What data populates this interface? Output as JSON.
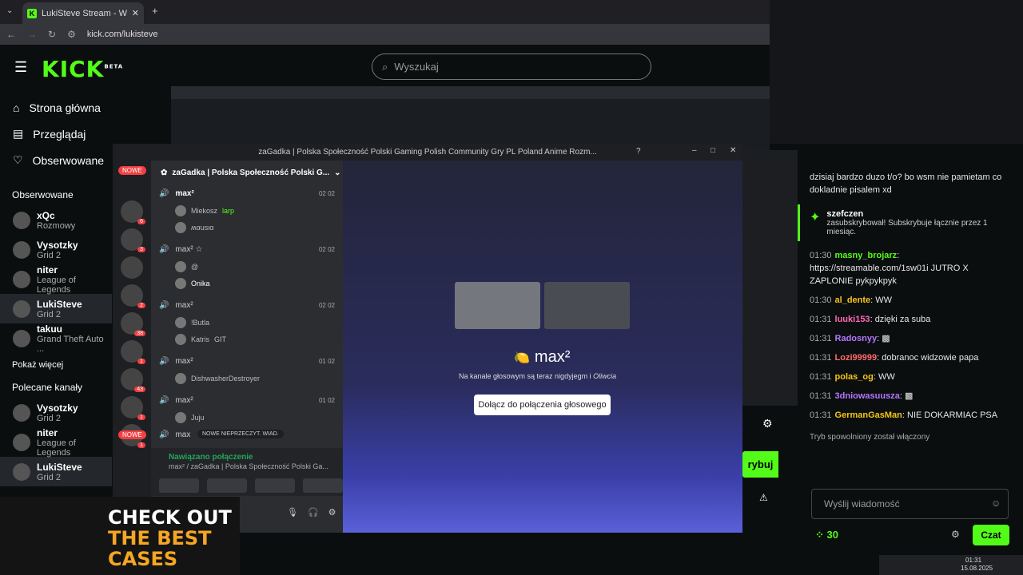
{
  "browser": {
    "tab_title": "LukiSteve Stream - Watch Live",
    "url": "kick.com/lukisteve"
  },
  "kick": {
    "logo": "KICK",
    "logo_badge": "BETA",
    "search_placeholder": "Wyszukaj",
    "nav": [
      {
        "icon": "home-icon",
        "label": "Strona główna"
      },
      {
        "icon": "browse-icon",
        "label": "Przeglądaj"
      },
      {
        "icon": "heart-icon",
        "label": "Obserwowane"
      }
    ],
    "followed_title": "Obserwowane",
    "followed": [
      {
        "name": "xQc",
        "game": "Rozmowy"
      },
      {
        "name": "Vysotzky",
        "game": "Grid 2"
      },
      {
        "name": "niter",
        "game": "League of Legends"
      },
      {
        "name": "LukiSteve",
        "game": "Grid 2"
      },
      {
        "name": "takuu",
        "game": "Grand Theft Auto ..."
      }
    ],
    "show_more": "Pokaż więcej",
    "recommended_title": "Polecane kanały",
    "recommended": [
      {
        "name": "Vysotzky",
        "game": "Grid 2"
      },
      {
        "name": "niter",
        "game": "League of Legends"
      },
      {
        "name": "LukiSteve",
        "game": "Grid 2"
      }
    ],
    "subscribe_btn": "rybuj"
  },
  "discord": {
    "title": "zaGadka | Polska Społeczność Polski Gaming Polish Community Gry PL Poland Anime Rozm...",
    "server_name": "zaGadka | Polska Społeczność Polski G...",
    "new_label": "NOWE",
    "server_badges": [
      "6",
      "3",
      "",
      "2",
      "38",
      "1",
      "43",
      "1",
      "1"
    ],
    "voice_channels": [
      {
        "name": "max²",
        "count_a": "02",
        "count_b": "02",
        "users": [
          {
            "name": "Miekosz",
            "tag": "larp"
          },
          {
            "name": "ʍαusια",
            "tag": ""
          }
        ]
      },
      {
        "name": "max² ☆",
        "count_a": "02",
        "count_b": "02",
        "users": [
          {
            "name": "@",
            "tag": ""
          },
          {
            "name": "Onika",
            "tag": ""
          }
        ]
      },
      {
        "name": "max²",
        "count_a": "02",
        "count_b": "02",
        "users": [
          {
            "name": "!Butla",
            "tag": ""
          },
          {
            "name": "Katris",
            "tag": "GIT"
          }
        ]
      },
      {
        "name": "max²",
        "count_a": "01",
        "count_b": "02",
        "users": [
          {
            "name": "DishwasherDestroyer",
            "tag": ""
          }
        ]
      },
      {
        "name": "max²",
        "count_a": "01",
        "count_b": "02",
        "users": [
          {
            "name": "Juju",
            "tag": ""
          }
        ]
      },
      {
        "name": "max",
        "count_a": "",
        "count_b": "",
        "users": []
      }
    ],
    "unread_pill": "NOWE NIEPRZECZYT. WIAD.",
    "connected_status": "Nawiązano połączenie",
    "connected_channel": "max² / zaGadka | Polska Społeczność Polski Ga...",
    "voice_channel_title": "max²",
    "voice_subtitle": "Na kanale głosowym są teraz nigdyjegm i",
    "voice_subtitle_name": "Oliwcia",
    "join_button": "Dołącz do połączenia głosowego"
  },
  "chat": {
    "messages": [
      {
        "time": "",
        "user": "",
        "text": "dzisiaj bardzo duzo t/o? bo wsm nie pamietam co dokladnie pisalem xd",
        "color": "#ffffff"
      },
      {
        "time": "01:30",
        "user": "masny_brojarz",
        "text": "https://streamable.com/1sw01i JUTRO X ZAPLONIE pykpykpyk",
        "color": "#53fc18"
      },
      {
        "time": "01:30",
        "user": "al_dente",
        "text": "WW",
        "color": "#f5c518"
      },
      {
        "time": "01:31",
        "user": "luuki153",
        "text": "dzięki za suba",
        "color": "#ff69b4"
      },
      {
        "time": "01:31",
        "user": "Radosnyy",
        "text": "",
        "color": "#b478ff"
      },
      {
        "time": "01:31",
        "user": "Lozi99999",
        "text": "dobranoc widzowie papa",
        "color": "#ff6b6b"
      },
      {
        "time": "01:31",
        "user": "polas_og",
        "text": "WW",
        "color": "#f5c518"
      },
      {
        "time": "01:31",
        "user": "3dniowasuusza",
        "text": "",
        "color": "#b478ff"
      },
      {
        "time": "01:31",
        "user": "GermanGasMan",
        "text": "NIE DOKARMIAC PSA",
        "color": "#f5c518"
      }
    ],
    "sub_user": "szefczen",
    "sub_text": "zasubskrybował! Subskrybuje łącznie przez 1 miesiąc.",
    "slow_mode": "Tryb spowolniony został włączony",
    "input_placeholder": "Wyślij wiadomość",
    "points": "30",
    "send_button": "Czat"
  },
  "taskbar": {
    "time": "01:31",
    "date": "15.08.2025"
  },
  "ad": {
    "line1": "CHECK OUT",
    "line2": "THE BEST",
    "line3": "CASES"
  }
}
